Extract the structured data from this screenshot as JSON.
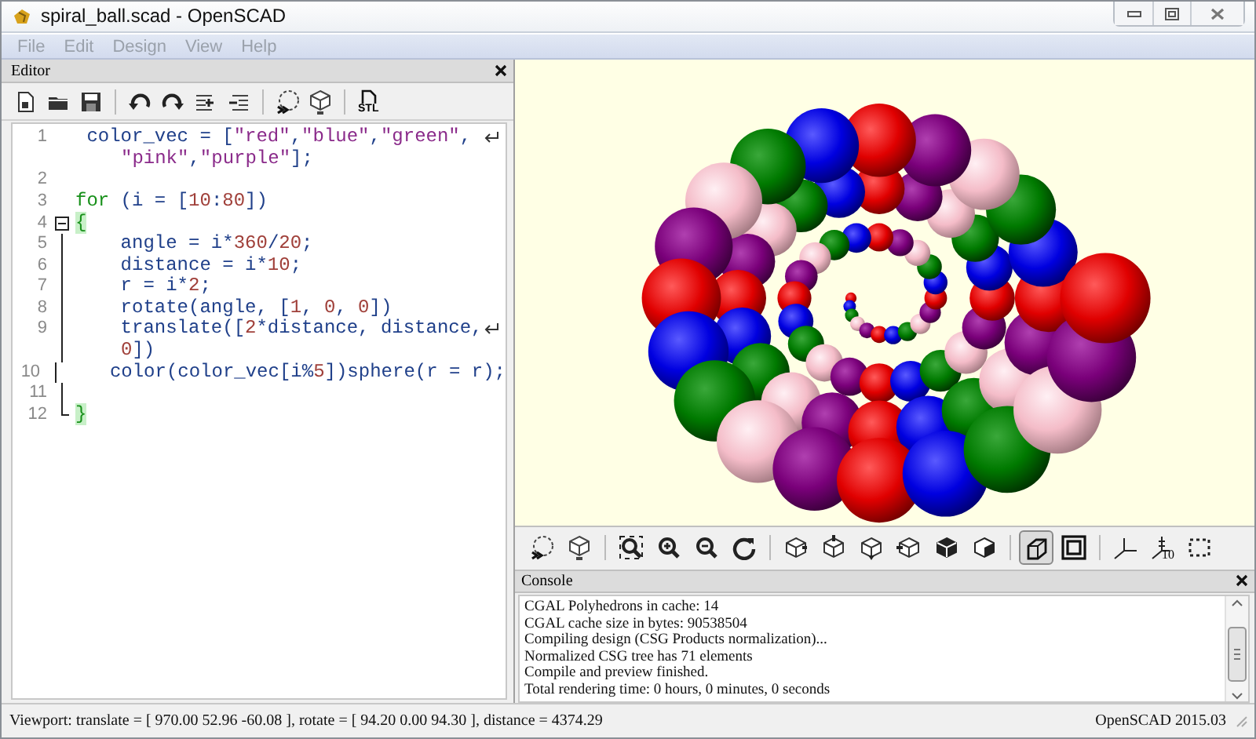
{
  "window": {
    "title": "spiral_ball.scad - OpenSCAD"
  },
  "menu": [
    {
      "label": "File",
      "disabled": true
    },
    {
      "label": "Edit",
      "disabled": true
    },
    {
      "label": "Design",
      "disabled": true
    },
    {
      "label": "View",
      "disabled": true
    },
    {
      "label": "Help",
      "disabled": true
    }
  ],
  "editor": {
    "title": "Editor",
    "stl_label": "STL",
    "lines": [
      {
        "number": "1",
        "kind": "plain",
        "tokens": [
          {
            "kind": "plain",
            "text": " color_vec = ["
          },
          {
            "kind": "string",
            "text": "\"red\""
          },
          {
            "kind": "plain",
            "text": ","
          },
          {
            "kind": "string",
            "text": "\"blue\""
          },
          {
            "kind": "plain",
            "text": ","
          },
          {
            "kind": "string",
            "text": "\"green\""
          },
          {
            "kind": "plain",
            "text": ","
          }
        ],
        "continuation": [
          {
            "kind": "string",
            "text": "\"pink\""
          },
          {
            "kind": "plain",
            "text": ","
          },
          {
            "kind": "string",
            "text": "\"purple\""
          },
          {
            "kind": "plain",
            "text": "];"
          }
        ]
      },
      {
        "number": "2",
        "kind": "plain"
      },
      {
        "number": "3",
        "kind": "plain",
        "tokens": [
          {
            "kind": "keyword",
            "text": "for"
          },
          {
            "kind": "plain",
            "text": " (i = ["
          },
          {
            "kind": "number",
            "text": "10"
          },
          {
            "kind": "plain",
            "text": ":"
          },
          {
            "kind": "number",
            "text": "80"
          },
          {
            "kind": "plain",
            "text": "])"
          }
        ]
      },
      {
        "number": "4",
        "kind": "fold_start",
        "tokens": [
          {
            "kind": "brace",
            "text": "{"
          }
        ]
      },
      {
        "number": "5",
        "kind": "fold_body",
        "tokens": [
          {
            "kind": "plain",
            "text": "    angle = i*"
          },
          {
            "kind": "number",
            "text": "360"
          },
          {
            "kind": "plain",
            "text": "/"
          },
          {
            "kind": "number",
            "text": "20"
          },
          {
            "kind": "plain",
            "text": ";"
          }
        ]
      },
      {
        "number": "6",
        "kind": "fold_body",
        "tokens": [
          {
            "kind": "plain",
            "text": "    distance = i*"
          },
          {
            "kind": "number",
            "text": "10"
          },
          {
            "kind": "plain",
            "text": ";"
          }
        ]
      },
      {
        "number": "7",
        "kind": "fold_body",
        "tokens": [
          {
            "kind": "plain",
            "text": "    r = i*"
          },
          {
            "kind": "number",
            "text": "2"
          },
          {
            "kind": "plain",
            "text": ";"
          }
        ]
      },
      {
        "number": "8",
        "kind": "fold_body",
        "tokens": [
          {
            "kind": "plain",
            "text": "    rotate(angle, ["
          },
          {
            "kind": "number",
            "text": "1"
          },
          {
            "kind": "plain",
            "text": ", "
          },
          {
            "kind": "number",
            "text": "0"
          },
          {
            "kind": "plain",
            "text": ", "
          },
          {
            "kind": "number",
            "text": "0"
          },
          {
            "kind": "plain",
            "text": "])"
          }
        ]
      },
      {
        "number": "9",
        "kind": "fold_body",
        "tokens": [
          {
            "kind": "plain",
            "text": "    translate(["
          },
          {
            "kind": "number",
            "text": "2"
          },
          {
            "kind": "plain",
            "text": "*distance, distance,"
          }
        ],
        "continuation": [
          {
            "kind": "number",
            "text": "0"
          },
          {
            "kind": "plain",
            "text": "])"
          }
        ]
      },
      {
        "number": "10",
        "kind": "fold_body",
        "tokens": [
          {
            "kind": "plain",
            "text": "    color(color_vec[i%"
          },
          {
            "kind": "number",
            "text": "5"
          },
          {
            "kind": "plain",
            "text": "])sphere(r = r);"
          }
        ]
      },
      {
        "number": "11",
        "kind": "fold_body"
      },
      {
        "number": "12",
        "kind": "fold_end",
        "tokens": [
          {
            "kind": "brace",
            "text": "}"
          }
        ]
      }
    ]
  },
  "view_toolbar": {
    "projection": [
      {
        "kind": "perspective",
        "selected": true
      },
      {
        "kind": "orthogonal",
        "selected": false
      }
    ],
    "scale_label": "10"
  },
  "console": {
    "title": "Console",
    "lines": [
      "CGAL Polyhedrons in cache: 14",
      "CGAL cache size in bytes: 90538504",
      "Compiling design (CSG Products normalization)...",
      "Normalized CSG tree has 71 elements",
      "Compile and preview finished.",
      "Total rendering time: 0 hours, 0 minutes, 0 seconds"
    ]
  },
  "status_bar": {
    "viewport": "Viewport: translate = [ 970.00 52.96 -60.08 ], rotate = [ 94.20 0.00 94.30 ], distance = 4374.29",
    "version": "OpenSCAD 2015.03"
  }
}
